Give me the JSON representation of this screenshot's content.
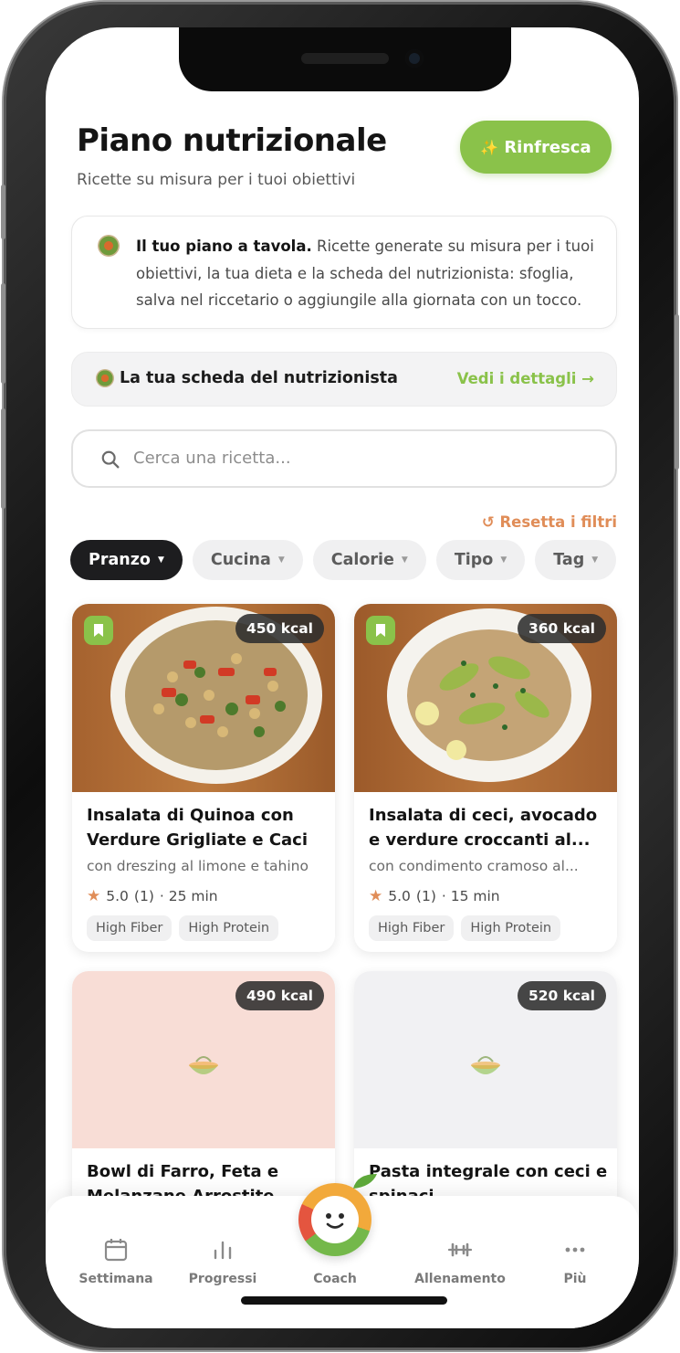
{
  "header": {
    "title": "Piano nutrizionale",
    "subtitle": "Ricette su misura per i tuoi obiettivi",
    "refresh_label": "Rinfresca",
    "refresh_icon": "sparkles-icon"
  },
  "intro": {
    "bold": "Il tuo piano a tavola.",
    "text": " Ricette generate su misura per i tuoi obiettivi, la tua dieta e la scheda del nutrizionista: sfoglia, salva nel riccetario o aggiungile alla giornata con un tocco."
  },
  "nutritionist": {
    "label": "La tua scheda del nutrizionista",
    "link": "Vedi i dettagli →"
  },
  "search": {
    "placeholder": "Cerca una ricetta...",
    "value": ""
  },
  "filters": {
    "reset_label": "Resetta i filtri",
    "chips": [
      {
        "label": "Pranzo",
        "active": true
      },
      {
        "label": "Cucina",
        "active": false
      },
      {
        "label": "Calorie",
        "active": false
      },
      {
        "label": "Tipo",
        "active": false
      },
      {
        "label": "Tag",
        "active": false
      }
    ]
  },
  "recipes": [
    {
      "kcal": "450 kcal",
      "saved": true,
      "title": "Insalata di Quinoa con Verdure Grigliate e Caci",
      "subtitle": "con dreszing al limone e tahino",
      "rating": "5.0",
      "reviews": "(1)",
      "time": "· 25 min",
      "tags": [
        "High Fiber",
        "High Protein"
      ]
    },
    {
      "kcal": "360 kcal",
      "saved": true,
      "title": "Insalata di ceci, avocado e verdure croccanti al...",
      "subtitle": "con condimento cramoso al...",
      "rating": "5.0",
      "reviews": "(1)",
      "time": "· 15 min",
      "tags": [
        "High Fiber",
        "High Protein"
      ]
    },
    {
      "kcal": "490 kcal",
      "title": "Bowl di Farro, Feta e Melanzane Arrostite"
    },
    {
      "kcal": "520 kcal",
      "title": "Pasta integrale con ceci e spinaci"
    }
  ],
  "nav": {
    "items": [
      {
        "label": "Settimana",
        "icon": "calendar-icon"
      },
      {
        "label": "Progressi",
        "icon": "bar-chart-icon"
      },
      {
        "label": "Coach",
        "icon": "coach-avatar-icon"
      },
      {
        "label": "Allenamento",
        "icon": "dumbbell-icon"
      },
      {
        "label": "Più",
        "icon": "more-dots-icon"
      }
    ]
  },
  "colors": {
    "accent_green": "#8ac24a",
    "accent_orange": "#e08d58",
    "chip_active": "#1d1d1f"
  }
}
